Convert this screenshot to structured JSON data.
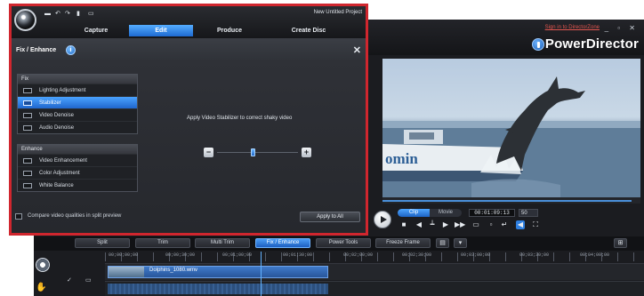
{
  "main_window": {
    "brand": "PowerDirector",
    "sign_in": "Sign in to DirectorZone",
    "window_controls": "_ ▫ ✕"
  },
  "preview": {
    "image": "dolphin leaping beside boat",
    "boat_text": "omin"
  },
  "player": {
    "mode_clip": "Clip",
    "mode_movie": "Movie",
    "timecode": "00:01:09:13",
    "fps": "50"
  },
  "room_tabs": [
    {
      "label": "Split",
      "active": false
    },
    {
      "label": "Trim",
      "active": false
    },
    {
      "label": "Multi Trim",
      "active": false
    },
    {
      "label": "Fix / Enhance",
      "active": true
    },
    {
      "label": "Power Tools",
      "active": false
    },
    {
      "label": "Freeze Frame",
      "active": false
    }
  ],
  "timeline": {
    "ruler_labels": [
      "00;00;00;00",
      "00;00;30;00",
      "00;01;00;00",
      "00;01;30;00",
      "00;02;00;00",
      "00;02;30;00",
      "00;03;00;00",
      "00;03;30;00",
      "00;04;00;00"
    ],
    "clip_label": "Dolphins_1080.wmv"
  },
  "editor": {
    "project_name": "New Untitled Project",
    "tabs": [
      {
        "label": "Capture",
        "active": false
      },
      {
        "label": "Edit",
        "active": true
      },
      {
        "label": "Produce",
        "active": false
      },
      {
        "label": "Create Disc",
        "active": false
      }
    ],
    "panel_title": "Fix / Enhance",
    "fix": {
      "header": "Fix",
      "items": [
        "Lighting Adjustment",
        "Stabilizer",
        "Video Denoise",
        "Audio Denoise"
      ],
      "selected": "Stabilizer"
    },
    "enhance": {
      "header": "Enhance",
      "items": [
        "Video Enhancement",
        "Color Adjustment",
        "White Balance"
      ]
    },
    "apply_message": "Apply Video Stabilizer to correct shaky video",
    "slider_level": 0.45,
    "compare_label": "Compare video qualities in split preview",
    "apply_all": "Apply to All"
  },
  "colors": {
    "border_highlight": "#d0262e",
    "accent_blue": "#1f66cc",
    "bg_dark": "#1b1c20"
  }
}
